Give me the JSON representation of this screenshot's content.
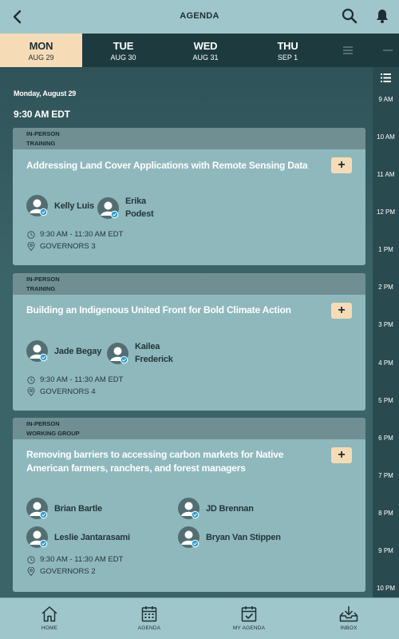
{
  "header": {
    "title": "AGENDA"
  },
  "days": [
    {
      "name": "MON",
      "date": "AUG 29"
    },
    {
      "name": "TUE",
      "date": "AUG 30"
    },
    {
      "name": "WED",
      "date": "AUG 31"
    },
    {
      "name": "THU",
      "date": "SEP 1"
    }
  ],
  "schedule": {
    "date_label": "Monday, August 29",
    "time_label": "9:30 AM EDT"
  },
  "sessions": [
    {
      "type": "IN-PERSON",
      "category": "TRAINING",
      "title": "Addressing Land Cover Applications with Remote Sensing Data",
      "speakers": [
        "Kelly Luis",
        "Erika\nPodest"
      ],
      "time": "9:30 AM - 11:30 AM EDT",
      "location": "GOVERNORS 3"
    },
    {
      "type": "IN-PERSON",
      "category": "TRAINING",
      "title": "Building an Indigenous United Front for Bold Climate Action",
      "speakers": [
        "Jade Begay",
        "Kailea\nFrederick"
      ],
      "time": "9:30 AM - 11:30 AM EDT",
      "location": "GOVERNORS 4"
    },
    {
      "type": "IN-PERSON",
      "category": "WORKING GROUP",
      "title": "Removing barriers to accessing carbon markets for Native American farmers, ranchers, and forest managers",
      "speakers": [
        "Brian Bartle",
        "JD Brennan",
        "Leslie Jantarasami",
        "Bryan Van Stippen"
      ],
      "time": "9:30 AM - 11:30 AM EDT",
      "location": "GOVERNORS 2"
    }
  ],
  "add_label": "+",
  "hours": [
    "9 AM",
    "10 AM",
    "11 AM",
    "12 PM",
    "1 PM",
    "2 PM",
    "3 PM",
    "4 PM",
    "5 PM",
    "6 PM",
    "7 PM",
    "8 PM",
    "9 PM",
    "10 PM"
  ],
  "nav": [
    {
      "label": "HOME",
      "icon": "home-icon"
    },
    {
      "label": "AGENDA",
      "icon": "calendar-icon"
    },
    {
      "label": "MY AGENDA",
      "icon": "calendar-check-icon"
    },
    {
      "label": "INBOX",
      "icon": "inbox-icon"
    }
  ],
  "colors": {
    "header": "#9fc6ca",
    "active_day": "#f6dcb6",
    "card": "#8fb8bd",
    "card_header": "#6f8f93"
  }
}
